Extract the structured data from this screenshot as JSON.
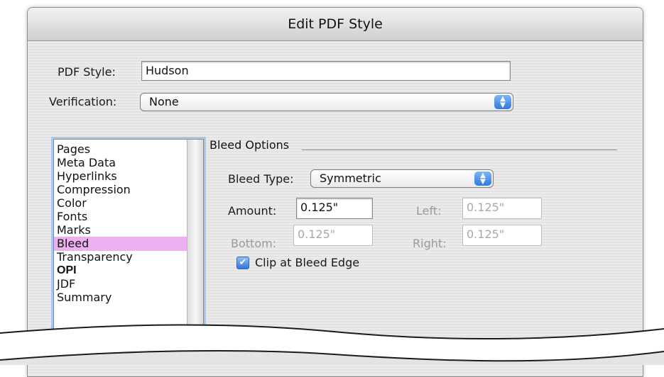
{
  "dialog": {
    "title": "Edit PDF Style",
    "pdf_style_label": "PDF Style:",
    "pdf_style_value": "Hudson",
    "verification_label": "Verification:",
    "verification_value": "None"
  },
  "categories": {
    "items": [
      "Pages",
      "Meta Data",
      "Hyperlinks",
      "Compression",
      "Color",
      "Fonts",
      "Marks",
      "Bleed",
      "Transparency",
      "OPI",
      "JDF",
      "Summary"
    ],
    "selected": "Bleed",
    "selected_color": "#ecb0f0"
  },
  "bleed": {
    "group_title": "Bleed Options",
    "type_label": "Bleed Type:",
    "type_value": "Symmetric",
    "amount_label": "Amount:",
    "amount_value": "0.125\"",
    "left_label": "Left:",
    "left_value": "0.125\"",
    "bottom_label": "Bottom:",
    "bottom_value": "0.125\"",
    "right_label": "Right:",
    "right_value": "0.125\"",
    "clip_label": "Clip at Bleed Edge",
    "clip_checked": true
  },
  "icons": {
    "popup": "up-down-arrows-icon",
    "checkbox": "checkmark-icon"
  }
}
